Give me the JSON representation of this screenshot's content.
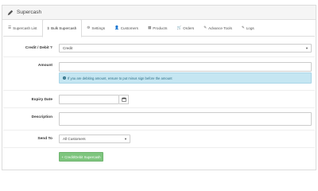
{
  "header": {
    "title": "Supercash"
  },
  "tabs": [
    {
      "icon": "☰",
      "label": "Supercash List"
    },
    {
      "icon": "$",
      "label": "Bulk Supercash"
    },
    {
      "icon": "⚙",
      "label": "Settings"
    },
    {
      "icon": "👤",
      "label": "Customers"
    },
    {
      "icon": "▦",
      "label": "Products"
    },
    {
      "icon": "🛒",
      "label": "Orders"
    },
    {
      "icon": "✎",
      "label": "Advance Tools"
    },
    {
      "icon": "✎",
      "label": "Logs"
    }
  ],
  "active_tab": "Bulk Supercash",
  "form": {
    "credit_debit": {
      "label": "Credit / Debit ?",
      "value": "Credit"
    },
    "amount": {
      "label": "Amount",
      "value": "",
      "notice": "If you are debiting amount, ensure to put minus sign before the amount"
    },
    "expiry_date": {
      "label": "Expiry Date",
      "value": ""
    },
    "description": {
      "label": "Description",
      "value": ""
    },
    "send_to": {
      "label": "Send To",
      "value": "All Customers"
    },
    "submit_label": "+ Credit/Debit Supercash"
  },
  "colors": {
    "accent_success": "#7ec57e",
    "info_bg": "#c5e6f2"
  }
}
